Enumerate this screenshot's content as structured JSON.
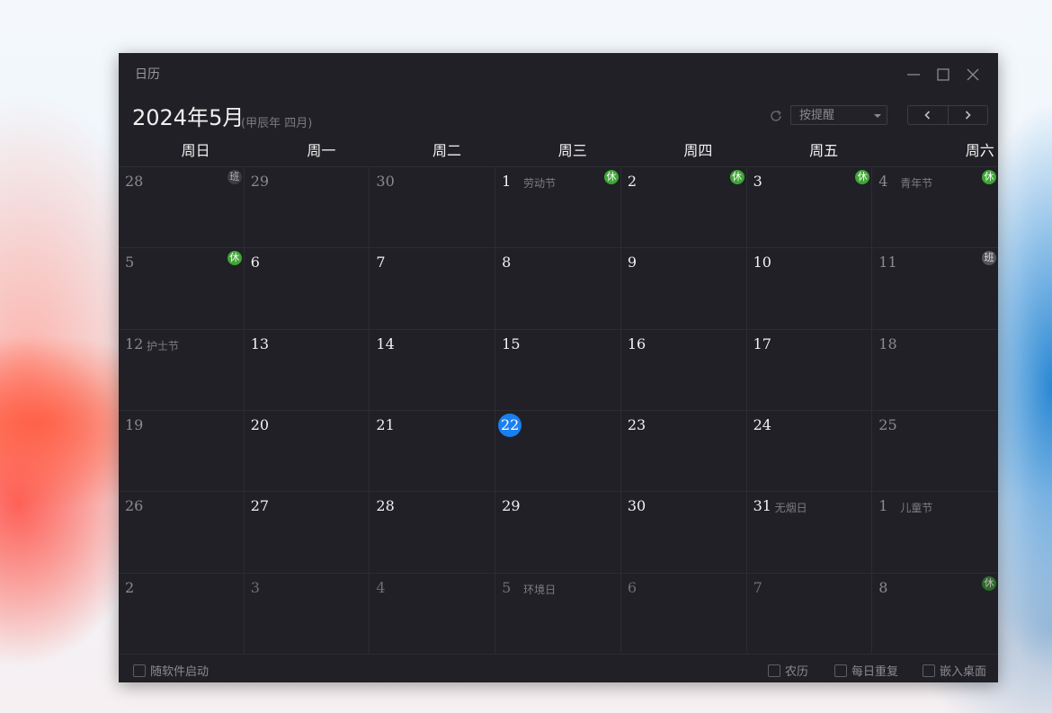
{
  "window": {
    "title": "日历",
    "controls": [
      "minimize",
      "maximize",
      "close"
    ]
  },
  "header": {
    "month_title": "2024年5月",
    "lunar_subtitle": "(甲辰年 四月)",
    "reminder_dropdown": {
      "selected": "按提醒"
    },
    "nav": {
      "prev_icon": "chevron-left-icon",
      "next_icon": "chevron-right-icon"
    },
    "refresh_icon": "refresh-icon"
  },
  "weekdays": [
    "周日",
    "周一",
    "周二",
    "周三",
    "周四",
    "周五",
    "周六"
  ],
  "days": [
    {
      "day": "28",
      "festival": "",
      "badge": "班",
      "badge_type": "work",
      "other": true,
      "weekend": true
    },
    {
      "day": "29",
      "festival": "",
      "badge": "",
      "other": true
    },
    {
      "day": "30",
      "festival": "",
      "badge": "",
      "other": true
    },
    {
      "day": "1",
      "festival": "劳动节",
      "badge": "休",
      "badge_type": "rest"
    },
    {
      "day": "2",
      "festival": "",
      "badge": "休",
      "badge_type": "rest"
    },
    {
      "day": "3",
      "festival": "",
      "badge": "休",
      "badge_type": "rest"
    },
    {
      "day": "4",
      "festival": "青年节",
      "badge": "休",
      "badge_type": "rest",
      "weekend": true
    },
    {
      "day": "5",
      "festival": "",
      "badge": "休",
      "badge_type": "rest",
      "weekend": true
    },
    {
      "day": "6",
      "festival": "",
      "badge": ""
    },
    {
      "day": "7",
      "festival": "",
      "badge": ""
    },
    {
      "day": "8",
      "festival": "",
      "badge": ""
    },
    {
      "day": "9",
      "festival": "",
      "badge": ""
    },
    {
      "day": "10",
      "festival": "",
      "badge": ""
    },
    {
      "day": "11",
      "festival": "",
      "badge": "班",
      "badge_type": "work",
      "weekend": true
    },
    {
      "day": "12",
      "festival": "护士节",
      "badge": "",
      "weekend": true
    },
    {
      "day": "13",
      "festival": "",
      "badge": ""
    },
    {
      "day": "14",
      "festival": "",
      "badge": ""
    },
    {
      "day": "15",
      "festival": "",
      "badge": ""
    },
    {
      "day": "16",
      "festival": "",
      "badge": ""
    },
    {
      "day": "17",
      "festival": "",
      "badge": ""
    },
    {
      "day": "18",
      "festival": "",
      "badge": "",
      "weekend": true
    },
    {
      "day": "19",
      "festival": "",
      "badge": "",
      "weekend": true
    },
    {
      "day": "20",
      "festival": "",
      "badge": ""
    },
    {
      "day": "21",
      "festival": "",
      "badge": ""
    },
    {
      "day": "22",
      "festival": "",
      "badge": "",
      "today": true
    },
    {
      "day": "23",
      "festival": "",
      "badge": ""
    },
    {
      "day": "24",
      "festival": "",
      "badge": ""
    },
    {
      "day": "25",
      "festival": "",
      "badge": "",
      "weekend": true
    },
    {
      "day": "26",
      "festival": "",
      "badge": "",
      "weekend": true
    },
    {
      "day": "27",
      "festival": "",
      "badge": ""
    },
    {
      "day": "28",
      "festival": "",
      "badge": ""
    },
    {
      "day": "29",
      "festival": "",
      "badge": ""
    },
    {
      "day": "30",
      "festival": "",
      "badge": ""
    },
    {
      "day": "31",
      "festival": "无烟日",
      "badge": ""
    },
    {
      "day": "1",
      "festival": "儿童节",
      "badge": "",
      "other": true,
      "weekend": true
    },
    {
      "day": "2",
      "festival": "",
      "badge": "",
      "other": true,
      "weekend": true
    },
    {
      "day": "3",
      "festival": "",
      "badge": "",
      "other": true,
      "faded": true
    },
    {
      "day": "4",
      "festival": "",
      "badge": "",
      "other": true,
      "faded": true
    },
    {
      "day": "5",
      "festival": "环境日",
      "badge": "",
      "other": true,
      "faded": true
    },
    {
      "day": "6",
      "festival": "",
      "badge": "",
      "other": true,
      "faded": true
    },
    {
      "day": "7",
      "festival": "",
      "badge": "",
      "other": true,
      "faded": true
    },
    {
      "day": "8",
      "festival": "",
      "badge": "休",
      "badge_type": "rest",
      "dim": true,
      "other": true
    }
  ],
  "footer": {
    "start_with_app": {
      "label": "随软件启动",
      "checked": false
    },
    "lunar": {
      "label": "农历",
      "checked": false
    },
    "daily_repeat": {
      "label": "每日重复",
      "checked": false
    },
    "embed_desktop": {
      "label": "嵌入桌面",
      "checked": false
    }
  },
  "colors": {
    "window_bg": "#202026",
    "today": "#1a7ff0",
    "rest_badge": "#3fa535",
    "work_badge": "#55555c"
  }
}
